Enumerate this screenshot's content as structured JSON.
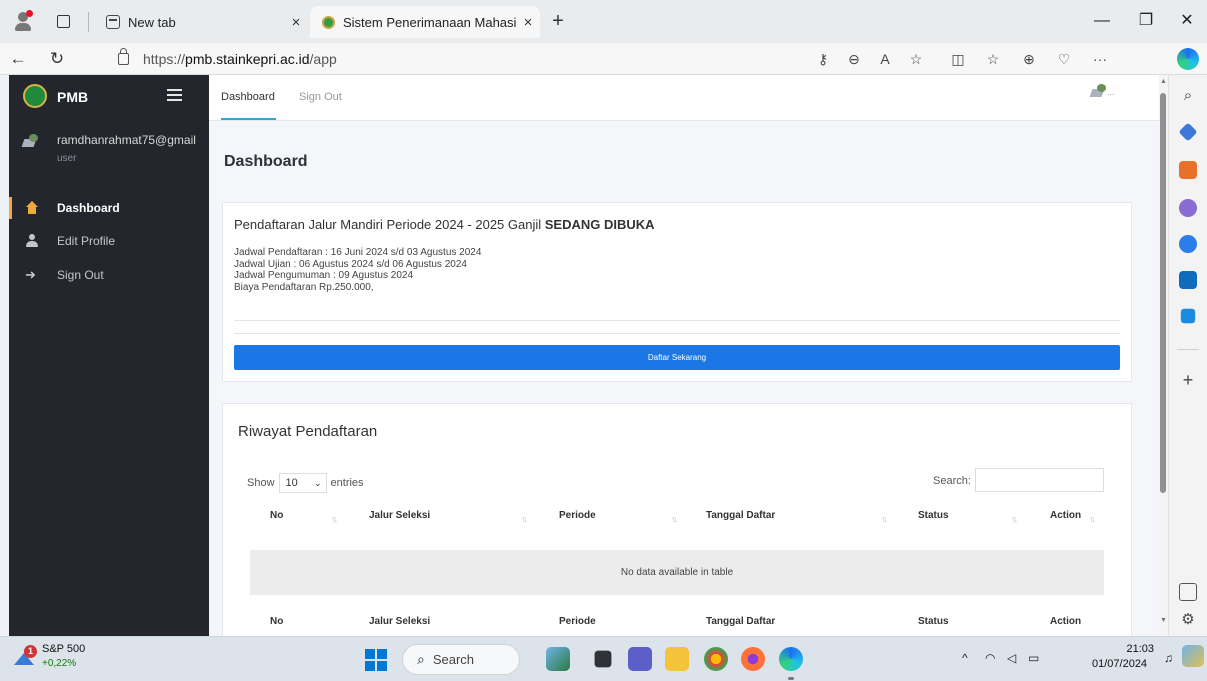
{
  "browser": {
    "tabs": [
      {
        "label": "New tab",
        "close": "×"
      },
      {
        "label": "Sistem Penerimanaan Mahasiswa",
        "close": "×"
      }
    ],
    "new_tab_symbol": "+",
    "window_controls": {
      "minimize": "—",
      "restore": "❐",
      "close": "✕"
    },
    "url_scheme": "https://",
    "url_host": "pmb.stainkepri.ac.id",
    "url_path": "/app",
    "nav": {
      "back": "←",
      "refresh": "↻"
    },
    "address_icons": [
      "key-icon",
      "zoom-icon",
      "read-aloud-icon",
      "favorite-star-icon",
      "split-screen-icon",
      "favorites-list-icon",
      "collections-icon",
      "browser-essentials-icon",
      "more-icon"
    ],
    "more_label": "···",
    "edge_sidebar": {
      "add_label": "+"
    }
  },
  "app": {
    "brand": "PMB",
    "user": {
      "email": "ramdhanrahmat75@gmail",
      "role": "user"
    },
    "menu": [
      {
        "label": "Dashboard",
        "icon": "home-icon",
        "active": true
      },
      {
        "label": "Edit Profile",
        "icon": "user-icon",
        "active": false
      },
      {
        "label": "Sign Out",
        "icon": "sign-out-icon",
        "active": false
      }
    ],
    "topnav": [
      {
        "label": "Dashboard",
        "active": true
      },
      {
        "label": "Sign Out",
        "active": false
      }
    ],
    "avatar_alt": "...",
    "page_title": "Dashboard",
    "info": {
      "title_prefix": "Pendaftaran Jalur Mandiri Periode 2024 - 2025 Ganjil",
      "title_status": "SEDANG DIBUKA",
      "lines": [
        "Jadwal Pendaftaran : 16 Juni 2024 s/d 03 Agustus 2024",
        "Jadwal Ujian : 06 Agustus 2024 s/d 06 Agustus 2024",
        "Jadwal Pengumuman : 09 Agustus 2024",
        "Biaya Pendaftaran Rp.250.000,"
      ],
      "button_label": "Daftar Sekarang"
    },
    "history": {
      "title": "Riwayat Pendaftaran",
      "show_label": "Show",
      "entries_value": "10",
      "entries_label": "entries",
      "search_label": "Search:",
      "columns": [
        "No",
        "Jalur Seleksi",
        "Periode",
        "Tanggal Daftar",
        "Status",
        "Action"
      ],
      "empty_message": "No data available in table",
      "sort_symbol": "↑↓"
    }
  },
  "taskbar": {
    "stock_name": "S&P 500",
    "stock_change": "+0,22%",
    "stock_badge": "1",
    "search_label": "Search",
    "time": "21:03",
    "date": "01/07/2024",
    "tray": {
      "chevron": "^",
      "wifi": "wifi-icon",
      "volume": "volume-icon",
      "battery": "battery-icon",
      "notification": "bell-icon"
    }
  },
  "colors": {
    "sidebar_bg": "#24262d",
    "accent_orange": "#f2a93b",
    "primary_button": "#1b76e6",
    "tab_underline": "#3aa0d8"
  }
}
